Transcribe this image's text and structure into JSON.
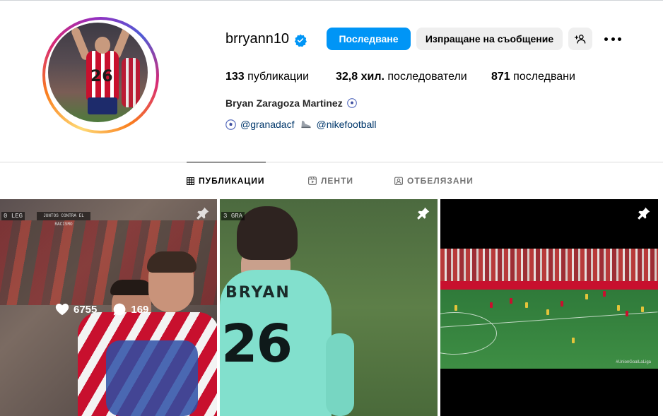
{
  "profile": {
    "username": "brryann10",
    "verified": true,
    "follow_label": "Последване",
    "message_label": "Изпращане на съобщение",
    "stats": {
      "posts_count": "133",
      "posts_label": "публикации",
      "followers_count": "32,8 хил.",
      "followers_label": "последователи",
      "following_count": "871",
      "following_label": "последвани"
    },
    "full_name": "Bryan Zaragoza Martinez",
    "links": [
      {
        "icon": "soccer-ball-icon",
        "text": "@granadacf"
      },
      {
        "icon": "football-boot-icon",
        "text": "@nikefootball"
      }
    ]
  },
  "tabs": [
    {
      "label": "ПУБЛИКАЦИИ",
      "icon": "grid-icon",
      "active": true
    },
    {
      "label": "ЛЕНТИ",
      "icon": "reels-icon",
      "active": false
    },
    {
      "label": "ОТБЕЛЯЗАНИ",
      "icon": "tagged-icon",
      "active": false
    }
  ],
  "posts": [
    {
      "pinned": true,
      "likes": "6755",
      "comments": "169",
      "score_left": "0",
      "score_team": "LEG",
      "banner": "JUNTOS CONTRA EL RACISMO"
    },
    {
      "pinned": true,
      "score_left": "3",
      "score_team": "GRA",
      "shirt_name": "BRYAN",
      "shirt_number": "26"
    },
    {
      "pinned": true,
      "watermark": "#UnionGoalLaLiga"
    }
  ],
  "colors": {
    "accent": "#0095f6",
    "secondary_button": "#efefef",
    "verified": "#0095f6",
    "link": "#00376b"
  }
}
